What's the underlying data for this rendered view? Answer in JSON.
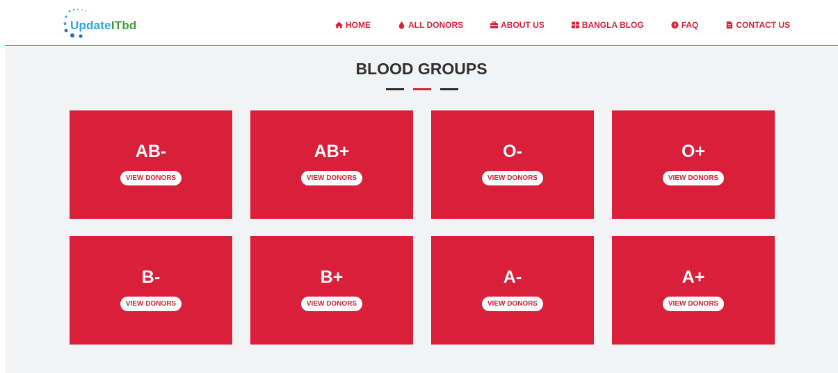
{
  "logo": {
    "part1": "Update",
    "part2": "ITbd"
  },
  "nav": [
    {
      "label": "HOME",
      "icon": "home-icon"
    },
    {
      "label": "ALL DONORS",
      "icon": "blood-drop-icon"
    },
    {
      "label": "ABOUT US",
      "icon": "briefcase-icon"
    },
    {
      "label": "BANGLA BLOG",
      "icon": "grid-icon"
    },
    {
      "label": "FAQ",
      "icon": "question-circle-icon"
    },
    {
      "label": "CONTACT US",
      "icon": "document-icon"
    }
  ],
  "section": {
    "title": "BLOOD GROUPS"
  },
  "groups": [
    {
      "name": "AB-",
      "button": "VIEW DONORS"
    },
    {
      "name": "AB+",
      "button": "VIEW DONORS"
    },
    {
      "name": "O-",
      "button": "VIEW DONORS"
    },
    {
      "name": "O+",
      "button": "VIEW DONORS"
    },
    {
      "name": "B-",
      "button": "VIEW DONORS"
    },
    {
      "name": "B+",
      "button": "VIEW DONORS"
    },
    {
      "name": "A-",
      "button": "VIEW DONORS"
    },
    {
      "name": "A+",
      "button": "VIEW DONORS"
    }
  ],
  "colors": {
    "accent": "#d91f3a",
    "background": "#f2f3f4",
    "title": "#303030",
    "logo_blue": "#2aa8df",
    "logo_green": "#3e9a3a"
  }
}
